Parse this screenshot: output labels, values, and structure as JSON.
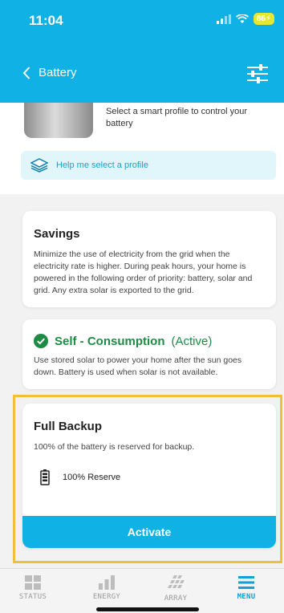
{
  "status_bar": {
    "time": "11:04",
    "battery": "86"
  },
  "header": {
    "title": "Battery"
  },
  "profile_header": {
    "description": "Select a smart profile to control your battery",
    "help_label": "Help me select a profile"
  },
  "profiles": {
    "savings": {
      "title": "Savings",
      "description": "Minimize the use of electricity from the grid when the electricity rate is higher. During peak hours, your home is powered in the following order of priority: battery, solar and grid. Any extra solar is exported to the grid."
    },
    "self_consumption": {
      "title": "Self - Consumption",
      "status": "(Active)",
      "description": "Use stored solar to power your home after the sun goes down. Battery is used when solar is not available."
    },
    "full_backup": {
      "title": "Full Backup",
      "description": "100% of the battery is reserved for backup.",
      "reserve": "100% Reserve",
      "activate_label": "Activate"
    }
  },
  "tabs": [
    {
      "label": "STATUS",
      "icon": "grid-icon"
    },
    {
      "label": "ENERGY",
      "icon": "bar-chart-icon"
    },
    {
      "label": "ARRAY",
      "icon": "solar-array-icon"
    },
    {
      "label": "MENU",
      "icon": "menu-icon"
    }
  ],
  "colors": {
    "brand": "#10b2e6",
    "active_green": "#1e8b45",
    "highlight": "#f2bf3b",
    "battery_badge": "#e3ea2d"
  }
}
